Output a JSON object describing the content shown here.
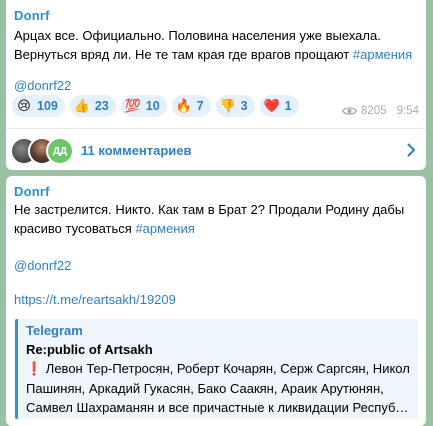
{
  "message1": {
    "author": "Donrf",
    "text_main": "Арцах все. Официально. Половина населения уже выехала. Вернуться вряд ли. Не те там края где врагов прощают ",
    "hashtag": "#армения",
    "mention": "@donrf22",
    "reactions": [
      {
        "emoji": "😢",
        "count": "109"
      },
      {
        "emoji": "👍",
        "count": "23"
      },
      {
        "emoji": "💯",
        "count": "10"
      },
      {
        "emoji": "🔥",
        "count": "7"
      },
      {
        "emoji": "👎",
        "count": "3"
      },
      {
        "emoji": "❤️",
        "count": "1"
      }
    ],
    "views": "8205",
    "time": "9:54",
    "comments": {
      "avatar3_initials": "ДД",
      "label": "11 комментариев"
    }
  },
  "message2": {
    "author": "Donrf",
    "text_main": "Не застрелится. Никто. Как там в Брат 2? Продали Родину дабы красиво тусоваться ",
    "hashtag": "#армения",
    "mention": "@donrf22",
    "link": "https://t.me/reartsakh/19209",
    "preview": {
      "site": "Telegram",
      "title": "Re:public of Artsakh",
      "excl": "❗",
      "description": " Левон Тер-Петросян, Роберт Кочарян, Серж Саргсян, Никол Пашинян, Аркадий Гукасян, Бако Саакян, Араик Арутюнян, Самвел Шахраманян и все причастные к ликвидации Респуб…"
    }
  },
  "colors": {
    "background": "#9bc1a3",
    "accent": "#2f80c3",
    "reaction_bg": "#e4f0fa"
  }
}
